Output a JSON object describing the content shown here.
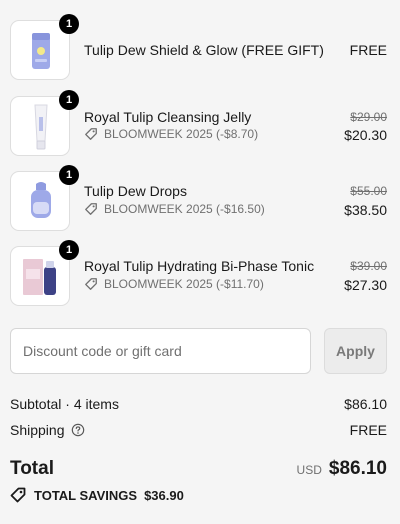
{
  "items": [
    {
      "name": "Tulip Dew Shield & Glow (FREE GIFT)",
      "quantity": "1",
      "original_price": "",
      "discount_code": "",
      "price": "FREE",
      "thumb_icon": "sunscreen-stick-icon"
    },
    {
      "name": "Royal Tulip Cleansing Jelly",
      "quantity": "1",
      "original_price": "$29.00",
      "discount_code": "BLOOMWEEK 2025 (-$8.70)",
      "price": "$20.30",
      "thumb_icon": "cleanser-tube-icon"
    },
    {
      "name": "Tulip Dew Drops",
      "quantity": "1",
      "original_price": "$55.00",
      "discount_code": "BLOOMWEEK 2025 (-$16.50)",
      "price": "$38.50",
      "thumb_icon": "serum-bottle-icon"
    },
    {
      "name": "Royal Tulip Hydrating Bi-Phase Tonic",
      "quantity": "1",
      "original_price": "$39.00",
      "discount_code": "BLOOMWEEK 2025 (-$11.70)",
      "price": "$27.30",
      "thumb_icon": "toner-bottle-box-icon"
    }
  ],
  "discount": {
    "placeholder": "Discount code or gift card",
    "value": "",
    "apply_label": "Apply"
  },
  "summary": {
    "subtotal_label": "Subtotal · 4 items",
    "subtotal_value": "$86.10",
    "shipping_label": "Shipping",
    "shipping_value": "FREE",
    "total_label": "Total",
    "currency": "USD",
    "total_value": "$86.10",
    "savings_label": "TOTAL SAVINGS",
    "savings_value": "$36.90"
  },
  "colors": {
    "accent": "#1a1a1a",
    "muted": "#707070",
    "background": "#f5f5f5",
    "badge": "#000000"
  }
}
